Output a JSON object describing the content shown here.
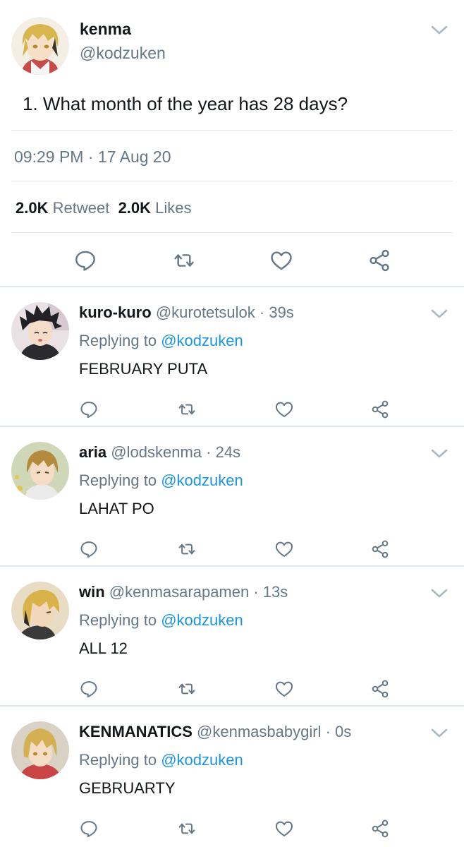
{
  "main_tweet": {
    "name": "kenma",
    "handle": "@kodzuken",
    "text": "1. What month of the year has 28 days?",
    "time": "09:29 PM",
    "date_sep": " · ",
    "date": "17 Aug 20",
    "retweet_count": "2.0K",
    "retweet_label": "Retweet",
    "like_count": "2.0K",
    "like_label": "Likes"
  },
  "replies": [
    {
      "name": "kuro-kuro",
      "handle": "@kurotetsulok",
      "time": "· 39s",
      "replying_label": "Replying to",
      "replying_to": "@kodzuken",
      "text": "FEBRUARY PUTA"
    },
    {
      "name": "aria",
      "handle": "@lodskenma",
      "time": "· 24s",
      "replying_label": "Replying to",
      "replying_to": "@kodzuken",
      "text": "LAHAT PO"
    },
    {
      "name": "win",
      "handle": "@kenmasarapamen",
      "time": "· 13s",
      "replying_label": "Replying to",
      "replying_to": "@kodzuken",
      "text": "ALL 12"
    },
    {
      "name": "KENMANATICS",
      "handle": "@kenmasbabygirl",
      "time": "· 0s",
      "replying_label": "Replying to",
      "replying_to": "@kodzuken",
      "text": "GEBRUARTY"
    }
  ],
  "icons": {
    "more": "chevron-down-icon",
    "reply": "reply-bubble-icon",
    "retweet": "retweet-icon",
    "like": "heart-icon",
    "share": "share-icon"
  },
  "colors": {
    "text": "#14171a",
    "secondary": "#657786",
    "link": "#1b95e0",
    "divider": "#e1e8ed"
  }
}
